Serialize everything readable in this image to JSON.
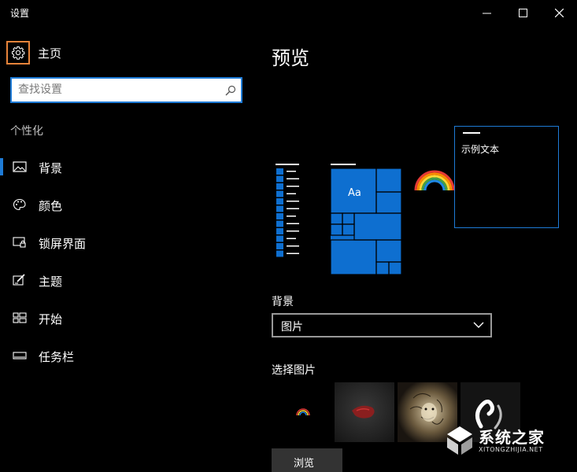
{
  "window": {
    "title": "设置"
  },
  "sidebar": {
    "home_label": "主页",
    "search_placeholder": "查找设置",
    "section": "个性化",
    "items": [
      {
        "label": "背景",
        "icon": "picture-icon",
        "active": true
      },
      {
        "label": "颜色",
        "icon": "palette-icon",
        "active": false
      },
      {
        "label": "锁屏界面",
        "icon": "lock-screen-icon",
        "active": false
      },
      {
        "label": "主题",
        "icon": "theme-brush-icon",
        "active": false
      },
      {
        "label": "开始",
        "icon": "start-grid-icon",
        "active": false
      },
      {
        "label": "任务栏",
        "icon": "taskbar-icon",
        "active": false
      }
    ]
  },
  "main": {
    "title": "预览",
    "preview": {
      "sample_text": "示例文本",
      "tile_text": "Aa"
    },
    "background_label": "背景",
    "background_value": "图片",
    "choose_label": "选择图片",
    "browse_label": "浏览"
  },
  "watermark": {
    "title": "系统之家",
    "subtitle": "XITONGZHIJIA.NET"
  },
  "colors": {
    "accent": "#1e7bd6",
    "home_highlight": "#e8843b",
    "background": "#000000"
  }
}
